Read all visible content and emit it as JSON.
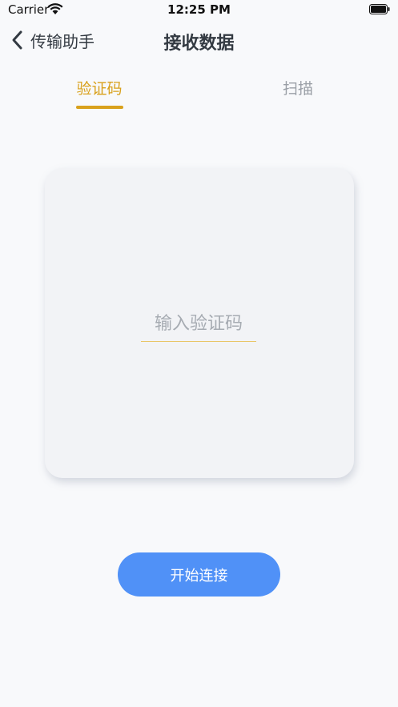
{
  "status_bar": {
    "carrier": "Carrier",
    "time": "12:25 PM"
  },
  "nav": {
    "back_label": "传输助手",
    "title": "接收数据"
  },
  "tabs": [
    {
      "label": "验证码",
      "active": true
    },
    {
      "label": "扫描",
      "active": false
    }
  ],
  "code_input": {
    "placeholder": "输入验证码",
    "value": ""
  },
  "connect_button": {
    "label": "开始连接"
  },
  "colors": {
    "accent": "#d9a11c",
    "primary_button": "#5091f7",
    "inactive_tab": "#9a9fa6",
    "background": "#f8f9fb"
  }
}
